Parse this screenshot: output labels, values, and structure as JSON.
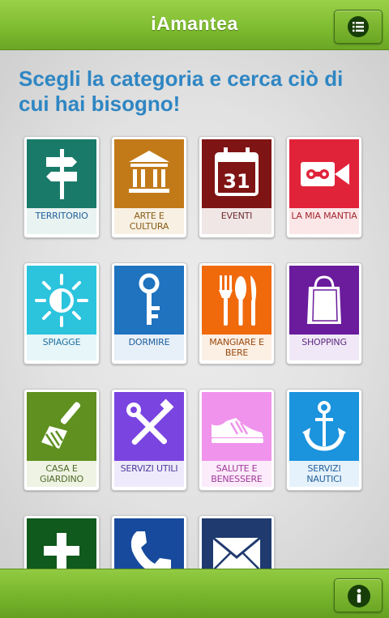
{
  "app_title": "iAmantea",
  "headline": "Scegli la categoria e cerca ciò di cui hai bisogno!",
  "colors": {
    "bar_green": "#7fbd30",
    "headline_blue": "#2f86c3"
  },
  "categories": [
    {
      "label": "TERRITORIO",
      "icon": "signpost-icon",
      "color": "#1a7a6a",
      "text_color": "#1f5f9c",
      "label_bg": "#e9f3f1"
    },
    {
      "label": "ARTE E CULTURA",
      "icon": "museum-icon",
      "color": "#c27a18",
      "text_color": "#8a5d17",
      "label_bg": "#f7f0e3"
    },
    {
      "label": "EVENTI",
      "icon": "calendar-icon",
      "color": "#7f1414",
      "text_color": "#6e2d2d",
      "label_bg": "#f1e6e6"
    },
    {
      "label": "LA MIA MANTIA",
      "icon": "video-camera-icon",
      "color": "#e1233a",
      "text_color": "#a3282f",
      "label_bg": "#fbe7e8"
    },
    {
      "label": "SPIAGGE",
      "icon": "sun-icon",
      "color": "#2cc4dd",
      "text_color": "#1f6fa0",
      "label_bg": "#e6f6f9"
    },
    {
      "label": "DORMIRE",
      "icon": "key-icon",
      "color": "#1f73bf",
      "text_color": "#1f5f9c",
      "label_bg": "#e7eff8"
    },
    {
      "label": "MANGIARE E BERE",
      "icon": "cutlery-icon",
      "color": "#f06a0c",
      "text_color": "#9a4a10",
      "label_bg": "#fcefe4"
    },
    {
      "label": "SHOPPING",
      "icon": "shopping-bag-icon",
      "color": "#6a1c9d",
      "text_color": "#5d2a82",
      "label_bg": "#f0e8f6"
    },
    {
      "label": "CASA E GIARDINO",
      "icon": "brush-icon",
      "color": "#5f9020",
      "text_color": "#4e6a26",
      "label_bg": "#eef3e4"
    },
    {
      "label": "SERVIZI UTILI",
      "icon": "tools-icon",
      "color": "#7a44e0",
      "text_color": "#4a3a9c",
      "label_bg": "#efeafb"
    },
    {
      "label": "SALUTE E BENESSERE",
      "icon": "sneaker-icon",
      "color": "#f093ec",
      "text_color": "#a1389b",
      "label_bg": "#fcebfb"
    },
    {
      "label": "SERVIZI NAUTICI",
      "icon": "anchor-icon",
      "color": "#1b93dd",
      "text_color": "#1f5f9c",
      "label_bg": "#e6f2fb"
    },
    {
      "label": "",
      "icon": "medical-cross-icon",
      "color": "#0f5a1c",
      "text_color": "#2f5a2f",
      "label_bg": "#e6efe7"
    },
    {
      "label": "",
      "icon": "phone-icon",
      "color": "#174a9c",
      "text_color": "#1f5f9c",
      "label_bg": "#e6ecf6"
    },
    {
      "label": "",
      "icon": "envelope-icon",
      "color": "#1f3a6e",
      "text_color": "#1f3a6e",
      "label_bg": "#e7eaf1"
    }
  ]
}
